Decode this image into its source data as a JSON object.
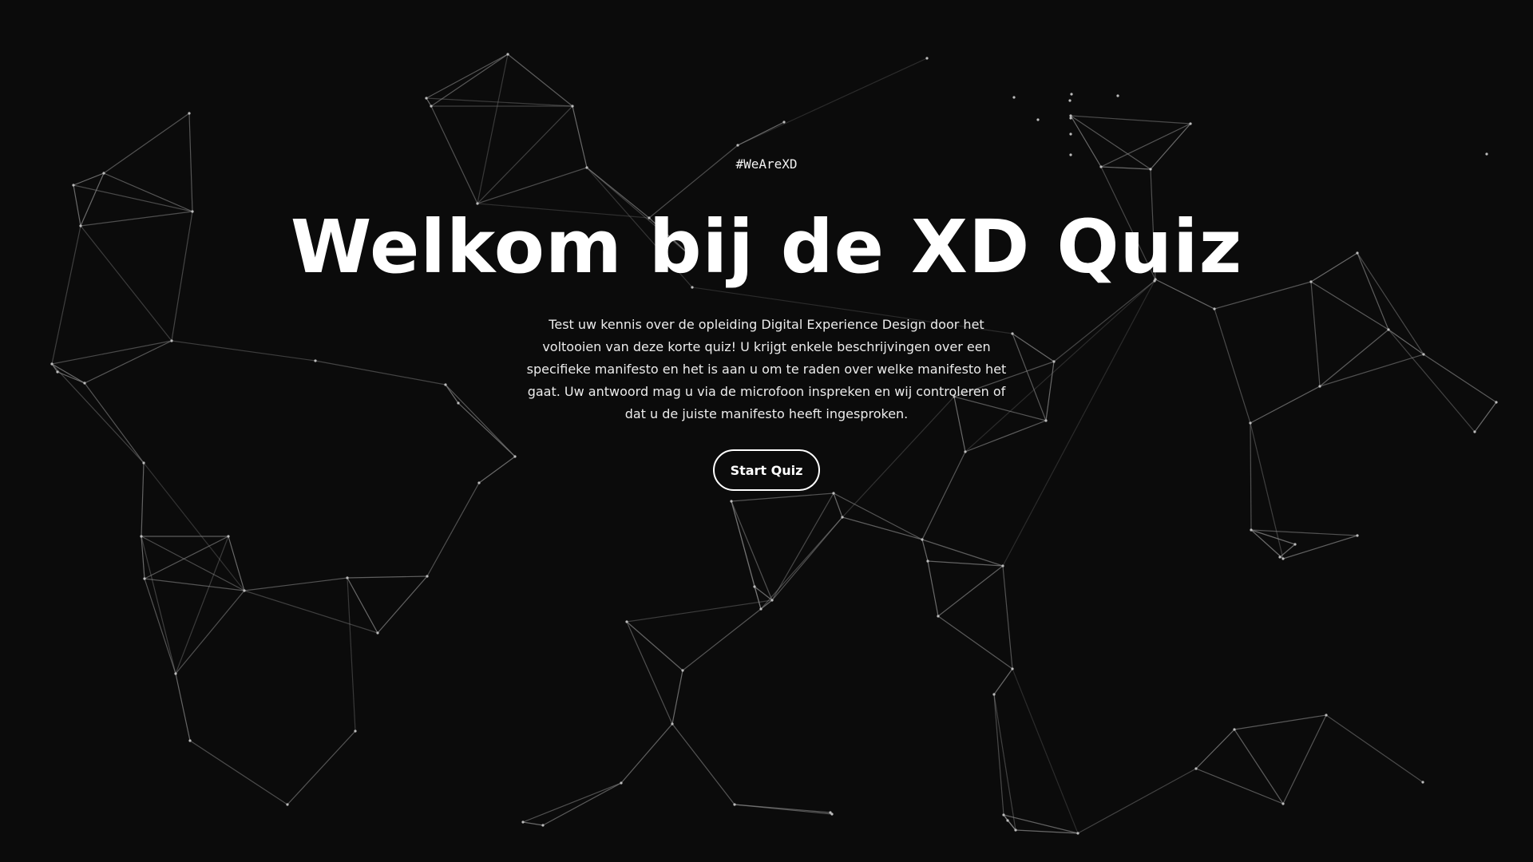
{
  "background": {
    "color": "#0b0b0b",
    "line_color": "#8a8a8a"
  },
  "hero": {
    "hashtag": "#WeAreXD",
    "title": "Welkom bij de XD Quiz",
    "description": "Test uw kennis over de opleiding Digital Experience Design door het voltooien van deze korte quiz! U krijgt enkele beschrijvingen over een specifieke manifesto en het is aan u om te raden over welke manifesto het gaat. Uw antwoord mag u via de microfoon inspreken en wij controleren of dat u de juiste manifesto heeft ingesproken.",
    "start_button": "Start Quiz"
  }
}
